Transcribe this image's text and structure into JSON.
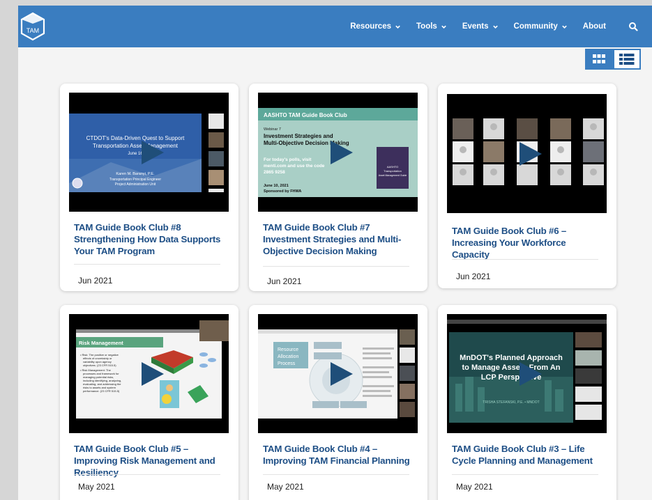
{
  "nav": {
    "logo_text": "TAM",
    "items": [
      {
        "label": "Resources",
        "has_dropdown": true
      },
      {
        "label": "Tools",
        "has_dropdown": true
      },
      {
        "label": "Events",
        "has_dropdown": true
      },
      {
        "label": "Community",
        "has_dropdown": true
      },
      {
        "label": "About",
        "has_dropdown": false
      }
    ],
    "search_icon": "search-icon"
  },
  "view_toggle": {
    "grid_icon": "grid-view-icon",
    "list_icon": "list-view-icon",
    "active": "grid"
  },
  "colors": {
    "primary": "#3a7dc0",
    "title": "#1e4f86",
    "play": "#1f4e79"
  },
  "cards": [
    {
      "title": "TAM Guide Book Club #8 Strengthening How Data Supports Your TAM Program",
      "date": "Jun 2021",
      "thumb": {
        "title_line1": "CTDOT's Data-Driven Quest to Support",
        "title_line2": "Transportation Asset Management",
        "date_line": "June 16",
        "presenter_line1": "Karen M. Baranyi, P.E.",
        "presenter_line2": "Transportation Principal Engineer",
        "presenter_line3": "Project Administration Unit"
      }
    },
    {
      "title": "TAM Guide Book Club #7 Investment Strategies and  Multi-Objective Decision Making",
      "date": "Jun 2021",
      "thumb": {
        "header": "AASHTO TAM Guide Book Club",
        "webinar": "Webinar 7",
        "title_line1": "Investment Strategies and",
        "title_line2": "Multi-Objective Decision Making",
        "poll_line1": "For today's polls, visit",
        "poll_line2": "menti.com and use the code",
        "poll_line3": "2865 9258",
        "date_line": "June 10, 2021",
        "sponsor_line": "Sponsored by FHWA",
        "book_line1": "AASHTO",
        "book_line2": "Transportation",
        "book_line3": "Asset Management Guide"
      }
    },
    {
      "title": "TAM Guide Book Club #6 – Increasing Your Workforce Capacity",
      "date": "Jun 2021",
      "thumb": {}
    },
    {
      "title": "TAM Guide Book Club #5 – Improving Risk Management and Resiliency",
      "date": "May 2021",
      "thumb": {
        "header": "Risk Management",
        "bullet1_line1": "• Risk: The positive or negative",
        "bullet1_line2": "effects of uncertainty or",
        "bullet1_line3": "variability upon agency",
        "bullet1_line4": "objectives. (23 CFR 515.5)",
        "bullet2_line1": "• Risk Management: The",
        "bullet2_line2": "processes and framework for",
        "bullet2_line3": "managing potential risks,",
        "bullet2_line4": "including identifying, analyzing,",
        "bullet2_line5": "evaluating, and addressing the",
        "bullet2_line6": "risks to assets and system",
        "bullet2_line7": "performance. (23 CFR 515.5)"
      }
    },
    {
      "title": "TAM Guide Book Club #4 – Improving TAM Financial Planning",
      "date": "May 2021",
      "thumb": {
        "box_line1": "Resource",
        "box_line2": "Allocation",
        "box_line3": "Process"
      }
    },
    {
      "title": "TAM Guide Book Club #3 – Life Cycle Planning and Management",
      "date": "May 2021",
      "thumb": {
        "title_line1": "MnDOT's Planned Approach",
        "title_line2": "to Manage Assets From An",
        "title_line3": "LCP Perspective",
        "presenter": "TRISHA STEFANSKI, P.E. • MNDOT"
      }
    }
  ]
}
